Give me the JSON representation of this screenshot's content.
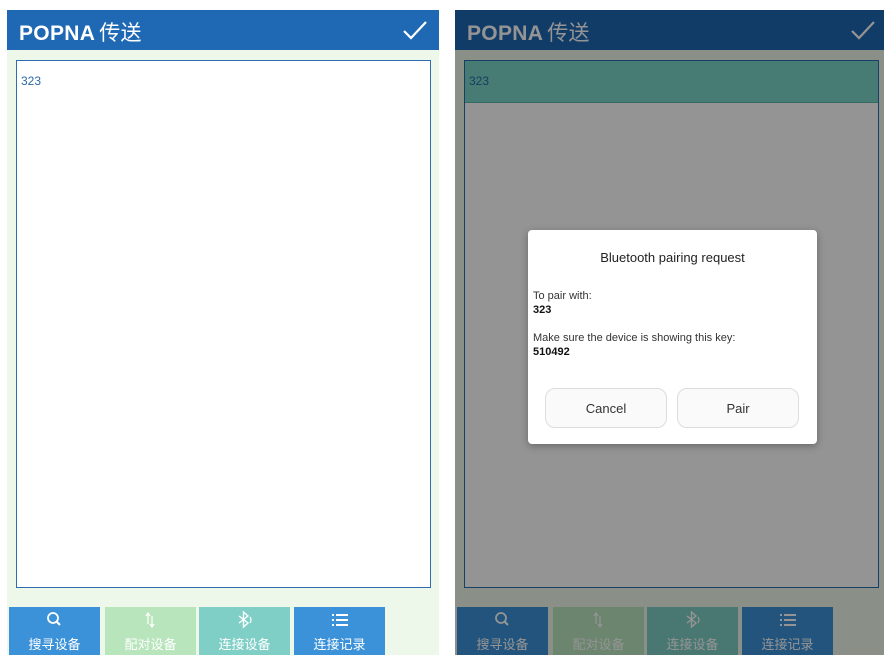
{
  "app": {
    "title": "POPNA",
    "title_cn": "传送"
  },
  "devices": [
    {
      "name": "323"
    }
  ],
  "toolbar": {
    "search_label": "搜寻设备",
    "pair_label": "配对设备",
    "connect_label": "连接设备",
    "history_label": "连接记录"
  },
  "dialog": {
    "title": "Bluetooth pairing request",
    "pair_with_label": "To pair with:",
    "device_name": "323",
    "key_prompt": "Make sure the device is showing this key:",
    "key": "510492",
    "cancel_label": "Cancel",
    "pair_label": "Pair"
  },
  "colors": {
    "header": "#1f68b3",
    "active_button": "#3b92d8",
    "disabled_button": "#b9e5bd",
    "connect_button": "#7fcfc7",
    "selected_item": "#79d6c6"
  },
  "icons": [
    "check-icon",
    "search-icon",
    "pair-arrows-icon",
    "bluetooth-icon",
    "list-icon"
  ]
}
